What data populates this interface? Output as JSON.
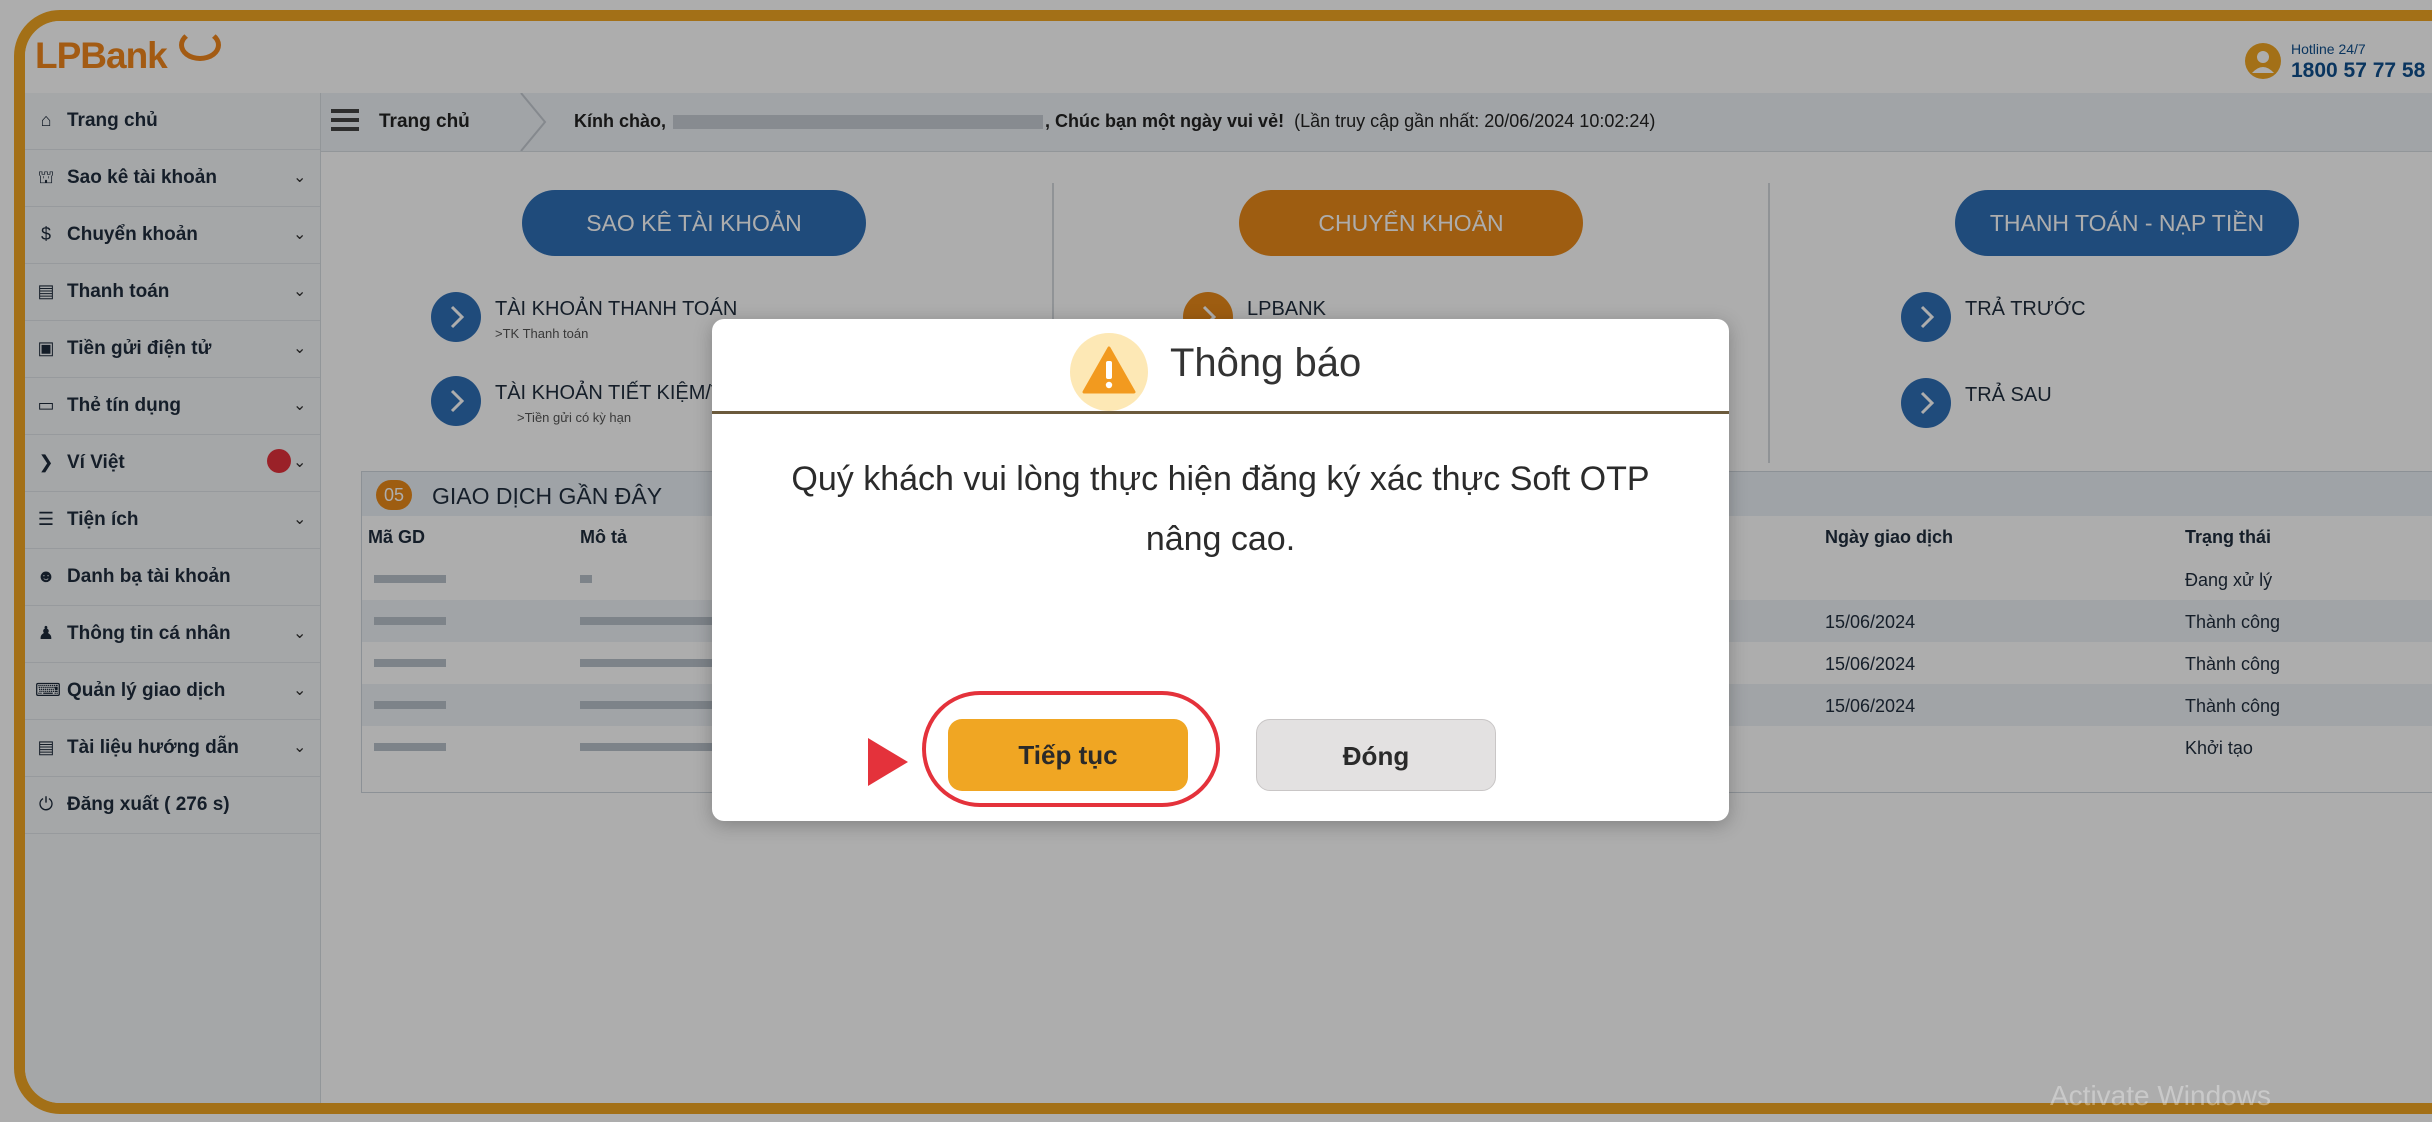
{
  "header": {
    "logo_text": "LPBank",
    "hotline_label": "Hotline 24/7",
    "hotline_number": "1800 57 77 58"
  },
  "sidebar": {
    "items": [
      {
        "label": "Trang chủ",
        "icon": "home-icon",
        "expandable": false
      },
      {
        "label": "Sao kê tài khoản",
        "icon": "bank-icon",
        "expandable": true
      },
      {
        "label": "Chuyển khoản",
        "icon": "dollar-icon",
        "expandable": true
      },
      {
        "label": "Thanh toán",
        "icon": "credit-card-icon",
        "expandable": true
      },
      {
        "label": "Tiền gửi điện tử",
        "icon": "money-icon",
        "expandable": true
      },
      {
        "label": "Thẻ tín dụng",
        "icon": "card-icon",
        "expandable": true
      },
      {
        "label": "Ví Việt",
        "icon": "wallet-icon",
        "expandable": true
      },
      {
        "label": "Tiện ích",
        "icon": "list-icon",
        "expandable": true
      },
      {
        "label": "Danh bạ tài khoản",
        "icon": "users-icon",
        "expandable": false
      },
      {
        "label": "Thông tin cá nhân",
        "icon": "user-icon",
        "expandable": true
      },
      {
        "label": "Quản lý giao dịch",
        "icon": "keyboard-icon",
        "expandable": true
      },
      {
        "label": "Tài liệu hướng dẫn",
        "icon": "document-icon",
        "expandable": true
      },
      {
        "label": "Đăng xuất ( 276 s)",
        "icon": "power-icon",
        "expandable": false
      }
    ]
  },
  "breadcrumb": {
    "home": "Trang chủ",
    "greeting_prefix": "Kính chào,",
    "greeting_suffix": ", Chúc bạn một ngày vui vẻ!",
    "last_access": "(Lần truy cập gần nhất: 20/06/2024 10:02:24)"
  },
  "quick_actions": {
    "statement": {
      "button": "SAO KÊ TÀI KHOẢN",
      "links": [
        {
          "title": "TÀI KHOẢN THANH TOÁN",
          "sub": ">TK Thanh toán"
        },
        {
          "title": "TÀI KHOẢN TIẾT KIỆM/VAY",
          "sub": ">Tiền gửi có kỳ hạn"
        }
      ]
    },
    "transfer": {
      "button": "CHUYỂN KHOẢN",
      "links": [
        {
          "title": "LPBANK",
          "sub": ""
        }
      ]
    },
    "payment": {
      "button": "THANH TOÁN - NẠP TIỀN",
      "links": [
        {
          "title": "TRẢ TRƯỚC",
          "sub": ""
        },
        {
          "title": "TRẢ SAU",
          "sub": ""
        }
      ]
    }
  },
  "recent": {
    "count": "05",
    "title": "GIAO DỊCH GẦN ĐÂY",
    "columns": [
      "Mã GD",
      "Mô tả",
      "Ngày giao dịch",
      "Trạng thái"
    ],
    "rows": [
      {
        "date": "",
        "status": "Đang xử lý"
      },
      {
        "date": "15/06/2024",
        "status": "Thành công"
      },
      {
        "date": "15/06/2024",
        "status": "Thành công"
      },
      {
        "date": "15/06/2024",
        "status": "Thành công"
      },
      {
        "date": "",
        "status": "Khởi tạo"
      }
    ]
  },
  "modal": {
    "title": "Thông báo",
    "message": "Quý khách vui lòng thực hiện đăng ký xác thực Soft OTP nâng cao.",
    "continue_label": "Tiếp tục",
    "close_label": "Đóng"
  },
  "watermark": "Activate Windows",
  "colors": {
    "frame": "#f0a623",
    "brand_blue": "#2f6fb6",
    "brand_orange": "#e98a1a",
    "highlight": "#e4323b"
  }
}
